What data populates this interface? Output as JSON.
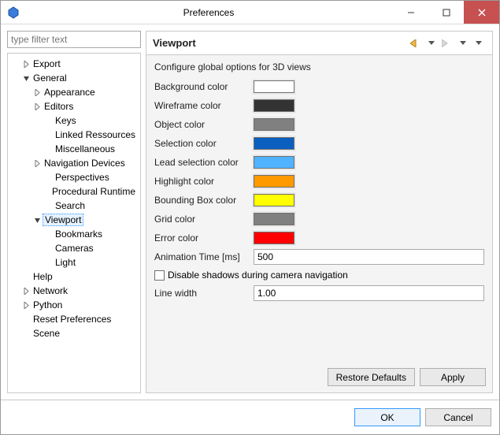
{
  "window": {
    "title": "Preferences"
  },
  "filter": {
    "placeholder": "type filter text"
  },
  "tree": [
    {
      "indent": 1,
      "twist": "closed",
      "label": "Export"
    },
    {
      "indent": 1,
      "twist": "open",
      "label": "General"
    },
    {
      "indent": 2,
      "twist": "closed",
      "label": "Appearance"
    },
    {
      "indent": 2,
      "twist": "closed",
      "label": "Editors"
    },
    {
      "indent": 3,
      "twist": "",
      "label": "Keys"
    },
    {
      "indent": 3,
      "twist": "",
      "label": "Linked Ressources"
    },
    {
      "indent": 3,
      "twist": "",
      "label": "Miscellaneous"
    },
    {
      "indent": 2,
      "twist": "closed",
      "label": "Navigation Devices"
    },
    {
      "indent": 3,
      "twist": "",
      "label": "Perspectives"
    },
    {
      "indent": 3,
      "twist": "",
      "label": "Procedural Runtime"
    },
    {
      "indent": 3,
      "twist": "",
      "label": "Search"
    },
    {
      "indent": 2,
      "twist": "open",
      "label": "Viewport",
      "selected": true
    },
    {
      "indent": 3,
      "twist": "",
      "label": "Bookmarks"
    },
    {
      "indent": 3,
      "twist": "",
      "label": "Cameras"
    },
    {
      "indent": 3,
      "twist": "",
      "label": "Light"
    },
    {
      "indent": 1,
      "twist": "",
      "label": "Help"
    },
    {
      "indent": 1,
      "twist": "closed",
      "label": "Network"
    },
    {
      "indent": 1,
      "twist": "closed",
      "label": "Python"
    },
    {
      "indent": 1,
      "twist": "",
      "label": "Reset Preferences"
    },
    {
      "indent": 1,
      "twist": "",
      "label": "Scene"
    }
  ],
  "page": {
    "title": "Viewport",
    "description": "Configure global options for 3D views",
    "colors": [
      {
        "label": "Background color",
        "value": "#ffffff"
      },
      {
        "label": "Wireframe color",
        "value": "#333333"
      },
      {
        "label": "Object color",
        "value": "#808080"
      },
      {
        "label": "Selection color",
        "value": "#0a5fbf"
      },
      {
        "label": "Lead selection color",
        "value": "#4fb3ff"
      },
      {
        "label": "Highlight color",
        "value": "#ff9900"
      },
      {
        "label": "Bounding Box color",
        "value": "#ffff00"
      },
      {
        "label": "Grid color",
        "value": "#808080"
      },
      {
        "label": "Error color",
        "value": "#ff0000"
      }
    ],
    "animTimeLabel": "Animation Time [ms]",
    "animTimeValue": "500",
    "disableShadowsLabel": "Disable shadows during camera navigation",
    "lineWidthLabel": "Line width",
    "lineWidthValue": "1.00"
  },
  "buttons": {
    "restore": "Restore Defaults",
    "apply": "Apply",
    "ok": "OK",
    "cancel": "Cancel"
  }
}
